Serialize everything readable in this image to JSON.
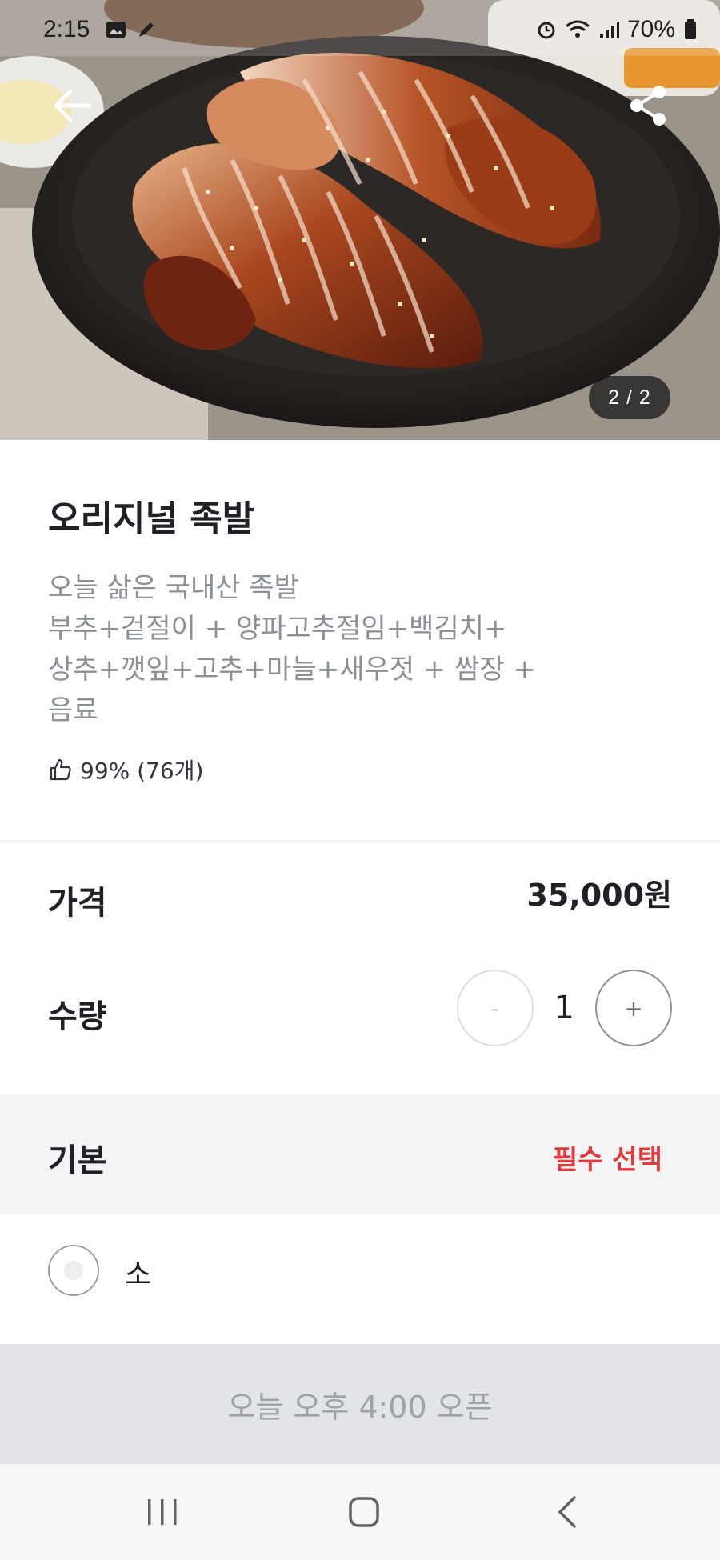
{
  "status_bar": {
    "time": "2:15",
    "battery": "70%",
    "icons": [
      "image-icon",
      "edit-icon",
      "alarm-icon",
      "wifi-icon",
      "signal-icon",
      "battery-icon"
    ]
  },
  "hero": {
    "page_indicator": "2 / 2",
    "icons": {
      "back": "arrow-left-icon",
      "share": "share-icon"
    }
  },
  "product": {
    "title": "오리지널 족발",
    "description_lines": [
      "오늘 삶은 국내산 족발",
      "부추+겉절이 + 양파고추절임+백김치+",
      "상추+깻잎+고추+마늘+새우젓 + 쌈장 +",
      "음료"
    ],
    "rating_text": "99% (76개)",
    "rating_icon": "thumbs-up-icon"
  },
  "price": {
    "label": "가격",
    "value": "35,000원"
  },
  "quantity": {
    "label": "수량",
    "value": "1",
    "minus": "-",
    "plus": "+"
  },
  "option_group": {
    "title": "기본",
    "required_text": "필수 선택",
    "required_color": "#e23a3a",
    "items": [
      {
        "label": "소",
        "selected": false
      }
    ]
  },
  "cta": {
    "label": "오늘 오후 4:00 오픈",
    "enabled": false
  },
  "nav_bar": {
    "icons": [
      "recents-icon",
      "home-icon",
      "back-icon"
    ]
  }
}
